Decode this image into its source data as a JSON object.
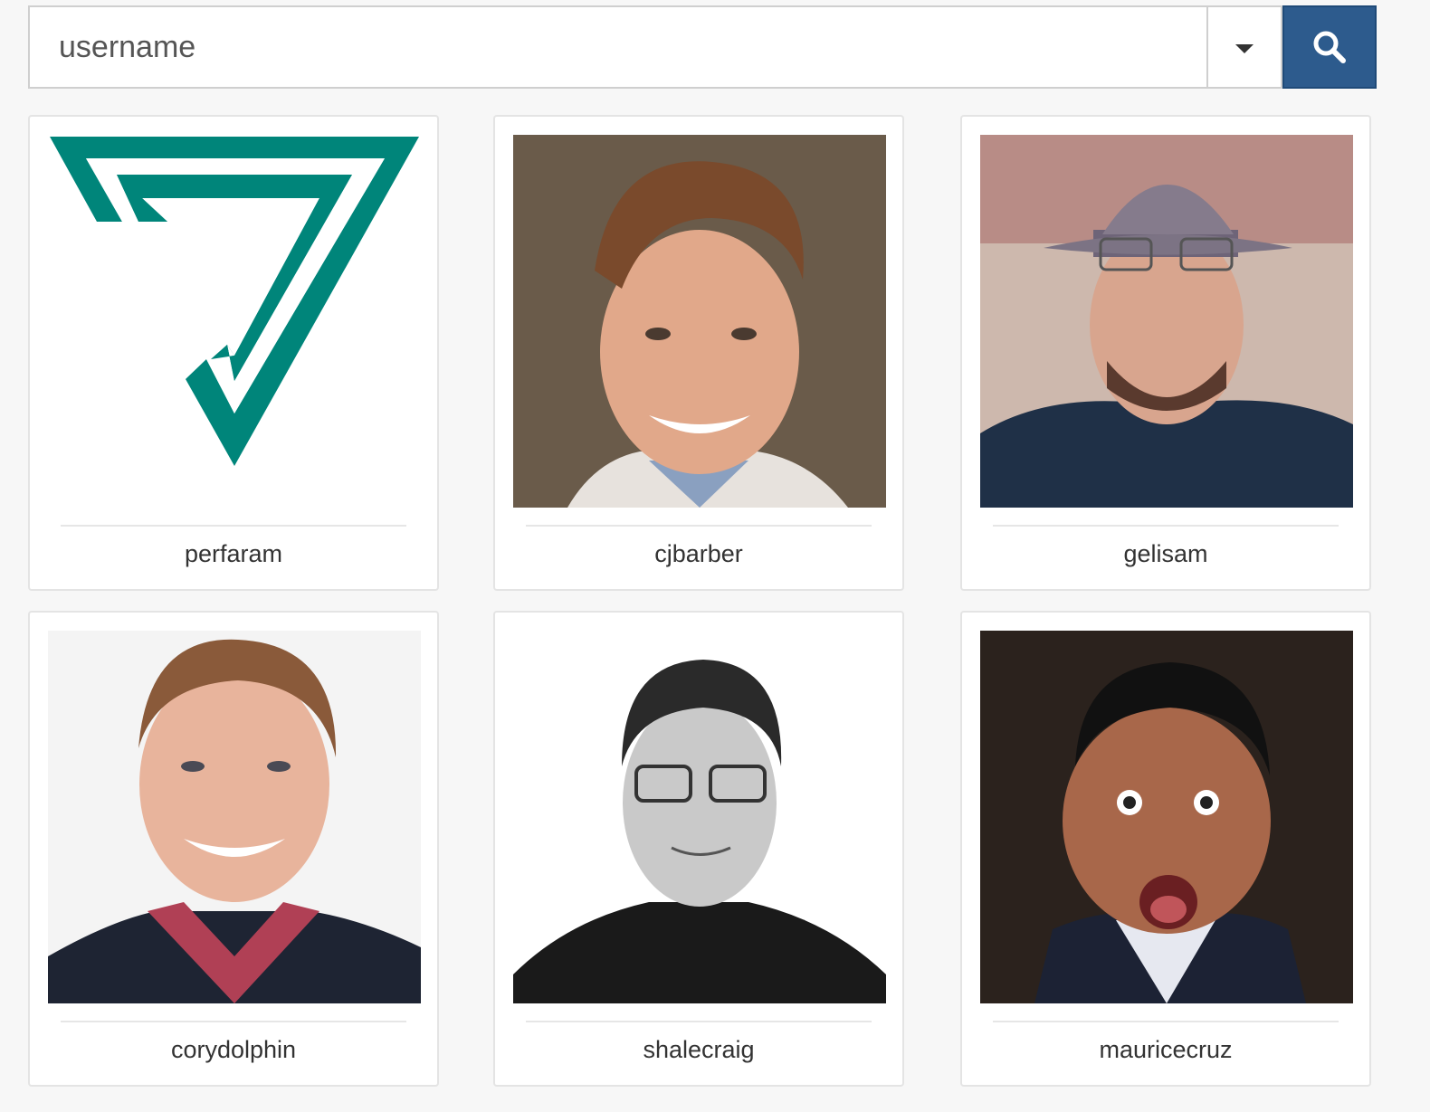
{
  "search": {
    "placeholder": "username",
    "search_icon": "search-icon",
    "dropdown_icon": "caret-down-icon",
    "button_color": "#2d5b8d"
  },
  "users": [
    {
      "username": "perfaram"
    },
    {
      "username": "cjbarber"
    },
    {
      "username": "gelisam"
    },
    {
      "username": "corydolphin"
    },
    {
      "username": "shalecraig"
    },
    {
      "username": "mauricecruz"
    }
  ],
  "colors": {
    "logo_teal": "#00857a"
  }
}
